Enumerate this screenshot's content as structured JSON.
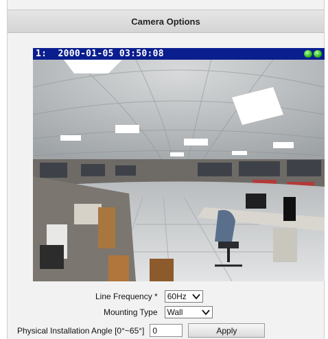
{
  "header": {
    "title": "Camera Options"
  },
  "video": {
    "osd_text": "1:  2000-01-05 03:50:08",
    "indicator_count": 2,
    "indicator_color": "#2fc02a"
  },
  "form": {
    "line_frequency": {
      "label": "Line Frequency *",
      "value": "60Hz"
    },
    "mounting_type": {
      "label": "Mounting Type",
      "value": "Wall"
    },
    "installation_angle": {
      "label": "Physical Installation Angle  [0°~65°]",
      "value": "0",
      "apply_label": "Apply"
    }
  },
  "colors": {
    "osd_bar": "#0b1e8e",
    "header_bg": "#dcdcdc",
    "panel_bg": "#f2f2f2"
  }
}
